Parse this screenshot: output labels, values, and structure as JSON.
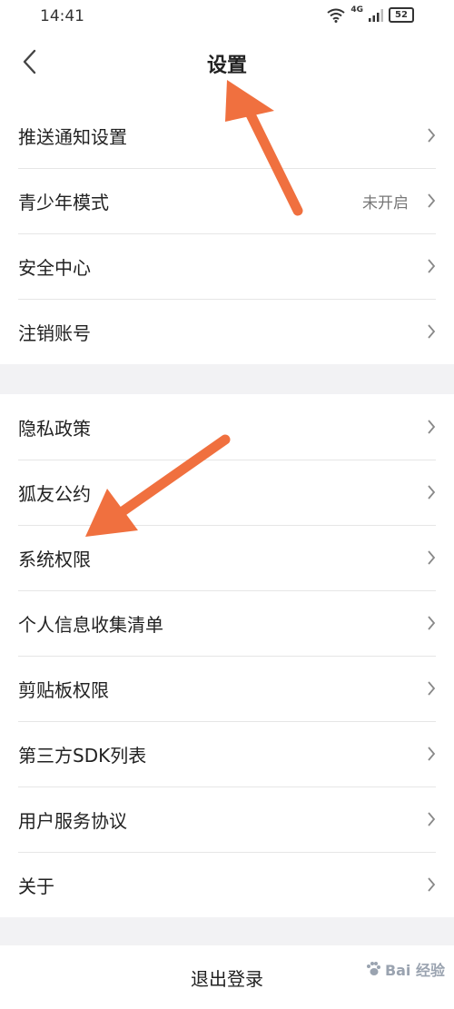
{
  "status_bar": {
    "time": "14:41",
    "network": "4G",
    "battery": "52"
  },
  "header": {
    "title": "设置"
  },
  "group1": [
    {
      "label": "推送通知设置",
      "value": ""
    },
    {
      "label": "青少年模式",
      "value": "未开启"
    },
    {
      "label": "安全中心",
      "value": ""
    },
    {
      "label": "注销账号",
      "value": ""
    }
  ],
  "group2": [
    {
      "label": "隐私政策"
    },
    {
      "label": "狐友公约"
    },
    {
      "label": "系统权限"
    },
    {
      "label": "个人信息收集清单"
    },
    {
      "label": "剪贴板权限"
    },
    {
      "label": "第三方SDK列表"
    },
    {
      "label": "用户服务协议"
    },
    {
      "label": "关于"
    }
  ],
  "footer": {
    "logout_label": "退出登录"
  },
  "watermark": {
    "text": "Bai 经验"
  },
  "colors": {
    "arrow": "#f0703f",
    "chevron": "#888888"
  }
}
